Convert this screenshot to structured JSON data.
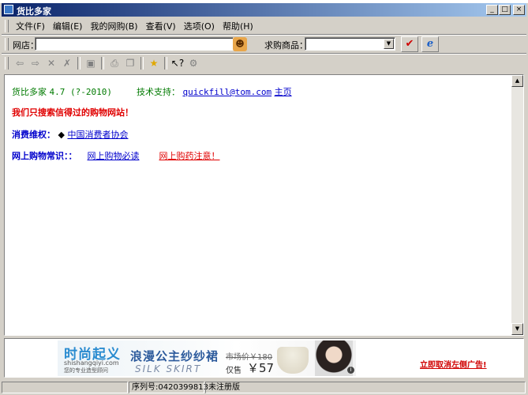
{
  "title": "货比多家",
  "window_controls": {
    "minimize": "_",
    "maximize": "□",
    "close": "×"
  },
  "menu": [
    "文件(F)",
    "编辑(E)",
    "我的网购(B)",
    "查看(V)",
    "选项(O)",
    "帮助(H)"
  ],
  "address_bar": {
    "shop_label": "网店：",
    "shop_value": "",
    "product_label": "求购商品：",
    "product_value": ""
  },
  "toolbar_icons": [
    "back-arrow-icon",
    "forward-arrow-icon",
    "stop-icon",
    "delete-icon",
    "save-icon",
    "print-icon",
    "copy-icon",
    "favorite-star-icon",
    "help-cursor-icon",
    "settings-icon"
  ],
  "content": {
    "line1": {
      "app": "货比多家",
      "version": "4.7 (?-2010)",
      "support_label": "技术支持：",
      "email": "quickfill@tom.com",
      "home": "主页"
    },
    "line2": "我们只搜索信得过的购物网站！",
    "line3": {
      "label": "消费维权：",
      "bullet": "◆",
      "link": "中国消费者协会"
    },
    "line4": {
      "label": "网上购物常识：：",
      "link1": "网上购物必读",
      "link2": "网上购药注意！"
    }
  },
  "ad": {
    "brand": "时尚起义",
    "domain": "shishangqiyi.com",
    "tagline": "您的专业造型顾问",
    "slogan": "浪漫公主纱纱裙",
    "english": "SILK SKIRT",
    "market_price": "市场价￥180",
    "price_label": "仅售",
    "price": "￥57",
    "info": "i",
    "cancel_link": "立即取消左侧广告!"
  },
  "status": {
    "serial": "序列号:0420399813",
    "reg": "未注册版"
  }
}
